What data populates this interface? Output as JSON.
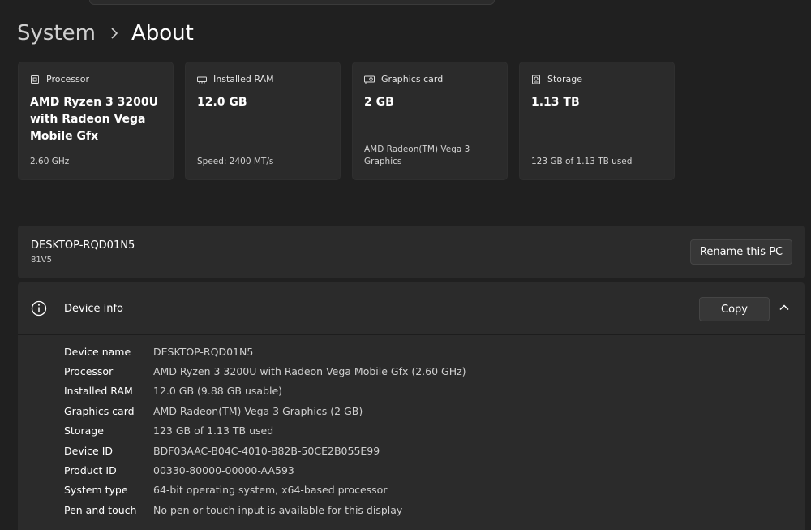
{
  "breadcrumb": {
    "parent": "System",
    "current": "About"
  },
  "specs": [
    {
      "icon": "processor-icon",
      "label": "Processor",
      "value": "AMD Ryzen 3 3200U with Radeon Vega Mobile Gfx",
      "sub": "2.60 GHz"
    },
    {
      "icon": "memory-icon",
      "label": "Installed RAM",
      "value": "12.0 GB",
      "sub": "Speed: 2400 MT/s"
    },
    {
      "icon": "graphics-card-icon",
      "label": "Graphics card",
      "value": "2 GB",
      "sub": "AMD Radeon(TM) Vega 3 Graphics"
    },
    {
      "icon": "storage-icon",
      "label": "Storage",
      "value": "1.13 TB",
      "sub": "123 GB of 1.13 TB used"
    }
  ],
  "pc": {
    "name": "DESKTOP-RQD01N5",
    "model": "81V5",
    "rename_label": "Rename this PC"
  },
  "device_info": {
    "icon": "info-icon",
    "title": "Device info",
    "copy_label": "Copy",
    "rows": [
      {
        "label": "Device name",
        "value": "DESKTOP-RQD01N5"
      },
      {
        "label": "Processor",
        "value": "AMD Ryzen 3 3200U with Radeon Vega Mobile Gfx (2.60 GHz)"
      },
      {
        "label": "Installed RAM",
        "value": "12.0 GB (9.88 GB usable)"
      },
      {
        "label": "Graphics card",
        "value": "AMD Radeon(TM) Vega 3 Graphics (2 GB)"
      },
      {
        "label": "Storage",
        "value": "123 GB of 1.13 TB used"
      },
      {
        "label": "Device ID",
        "value": "BDF03AAC-B04C-4010-B82B-50CE2B055E99"
      },
      {
        "label": "Product ID",
        "value": "00330-80000-00000-AA593"
      },
      {
        "label": "System type",
        "value": "64-bit operating system, x64-based processor"
      },
      {
        "label": "Pen and touch",
        "value": "No pen or touch input is available for this display"
      }
    ]
  }
}
